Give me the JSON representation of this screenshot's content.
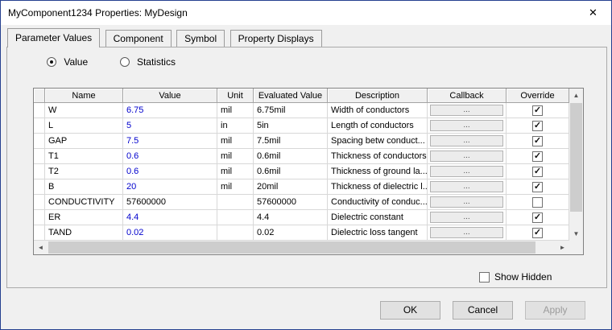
{
  "window": {
    "title": "MyComponent1234 Properties: MyDesign",
    "close_glyph": "✕"
  },
  "tabs": [
    {
      "label": "Parameter Values",
      "active": true
    },
    {
      "label": "Component",
      "active": false
    },
    {
      "label": "Symbol",
      "active": false
    },
    {
      "label": "Property Displays",
      "active": false
    }
  ],
  "options": {
    "value_label": "Value",
    "statistics_label": "Statistics",
    "selected": "Value"
  },
  "table": {
    "headers": [
      "Name",
      "Value",
      "Unit",
      "Evaluated Value",
      "Description",
      "Callback",
      "Override"
    ],
    "rows": [
      {
        "name": "W",
        "value": "6.75",
        "value_color": "#0000cd",
        "unit": "mil",
        "evaluated": "6.75mil",
        "description": "Width of conductors",
        "callback": "...",
        "override": true
      },
      {
        "name": "L",
        "value": "5",
        "value_color": "#0000cd",
        "unit": "in",
        "evaluated": "5in",
        "description": "Length of conductors",
        "callback": "...",
        "override": true
      },
      {
        "name": "GAP",
        "value": "7.5",
        "value_color": "#0000cd",
        "unit": "mil",
        "evaluated": "7.5mil",
        "description": "Spacing betw conduct...",
        "callback": "...",
        "override": true
      },
      {
        "name": "T1",
        "value": "0.6",
        "value_color": "#0000cd",
        "unit": "mil",
        "evaluated": "0.6mil",
        "description": "Thickness of conductors",
        "callback": "...",
        "override": true
      },
      {
        "name": "T2",
        "value": "0.6",
        "value_color": "#0000cd",
        "unit": "mil",
        "evaluated": "0.6mil",
        "description": "Thickness of ground la...",
        "callback": "...",
        "override": true
      },
      {
        "name": "B",
        "value": "20",
        "value_color": "#0000cd",
        "unit": "mil",
        "evaluated": "20mil",
        "description": "Thickness of dielectric l...",
        "callback": "...",
        "override": true
      },
      {
        "name": "CONDUCTIVITY",
        "value": "57600000",
        "value_color": "#000000",
        "unit": "",
        "evaluated": "57600000",
        "description": "Conductivity of conduc...",
        "callback": "...",
        "override": false
      },
      {
        "name": "ER",
        "value": "4.4",
        "value_color": "#0000cd",
        "unit": "",
        "evaluated": "4.4",
        "description": "Dielectric constant",
        "callback": "...",
        "override": true
      },
      {
        "name": "TAND",
        "value": "0.02",
        "value_color": "#0000cd",
        "unit": "",
        "evaluated": "0.02",
        "description": "Dielectric loss tangent",
        "callback": "...",
        "override": true
      }
    ]
  },
  "show_hidden": {
    "label": "Show Hidden",
    "checked": false
  },
  "buttons": {
    "ok": "OK",
    "cancel": "Cancel",
    "apply": "Apply",
    "apply_enabled": false
  },
  "icons": {
    "check": "✓",
    "scroll_up": "▲",
    "scroll_down": "▼",
    "scroll_left": "◄",
    "scroll_right": "►"
  },
  "colors": {
    "accent_border": "#25408f",
    "value_text": "#0000cd"
  }
}
